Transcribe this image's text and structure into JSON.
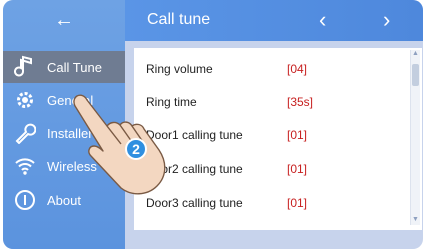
{
  "sidebar": {
    "back_icon": "arrow-left-icon",
    "items": [
      {
        "label": "Call Tune",
        "icon": "music-note-icon",
        "active": true
      },
      {
        "label": "General",
        "icon": "gear-icon",
        "active": false
      },
      {
        "label": "Installer",
        "icon": "wrench-icon",
        "active": false
      },
      {
        "label": "Wireless",
        "icon": "wifi-icon",
        "active": false
      },
      {
        "label": "About",
        "icon": "info-icon",
        "active": false
      }
    ]
  },
  "header": {
    "title": "Call tune",
    "prev_icon": "chevron-left-icon",
    "next_icon": "chevron-right-icon"
  },
  "settings": [
    {
      "name": "Ring volume",
      "value": "[04]"
    },
    {
      "name": "Ring time",
      "value": "[35s]"
    },
    {
      "name": "Door1 calling tune",
      "value": "[01]"
    },
    {
      "name": "Door2 calling tune",
      "value": "[01]"
    },
    {
      "name": "Door3 calling tune",
      "value": "[01]"
    }
  ],
  "overlay": {
    "step_badge": "2",
    "icon": "pointing-hand-icon"
  },
  "colors": {
    "accent": "#5b93de",
    "active_item": "#6f7c92",
    "value_text": "#c72020"
  }
}
